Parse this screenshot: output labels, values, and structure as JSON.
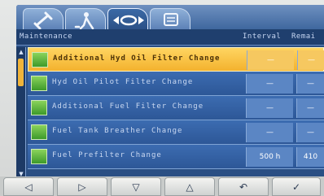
{
  "tabs": [
    {
      "name": "plug-icon"
    },
    {
      "name": "service-person-icon"
    },
    {
      "name": "filter-icon",
      "active": true
    },
    {
      "name": "list-icon"
    }
  ],
  "header": {
    "title": "Maintenance",
    "col_interval": "Interval",
    "col_remain": "Remai"
  },
  "rows": [
    {
      "name": "Additional Hyd Oil Filter Change",
      "interval": "—",
      "remain": "—",
      "selected": true
    },
    {
      "name": "Hyd Oil Pilot Filter Change",
      "interval": "—",
      "remain": "—"
    },
    {
      "name": "Additional Fuel Filter Change",
      "interval": "—",
      "remain": "—"
    },
    {
      "name": "Fuel Tank Breather Change",
      "interval": "—",
      "remain": "—"
    },
    {
      "name": "Fuel Prefilter Change",
      "interval": "500 h",
      "remain": "410"
    }
  ],
  "softkeys": [
    {
      "glyph": "◁",
      "name": "left-arrow-button"
    },
    {
      "glyph": "▷",
      "name": "right-arrow-button"
    },
    {
      "glyph": "▽",
      "name": "down-arrow-button"
    },
    {
      "glyph": "△",
      "name": "up-arrow-button"
    },
    {
      "glyph": "↶",
      "name": "return-button"
    },
    {
      "glyph": "✓",
      "name": "confirm-button"
    }
  ],
  "colors": {
    "screen_bg": "#2a4f84",
    "row_selected": "#f3b22e",
    "row_normal": "#2d5797",
    "icon_green": "#3d9a2a"
  }
}
